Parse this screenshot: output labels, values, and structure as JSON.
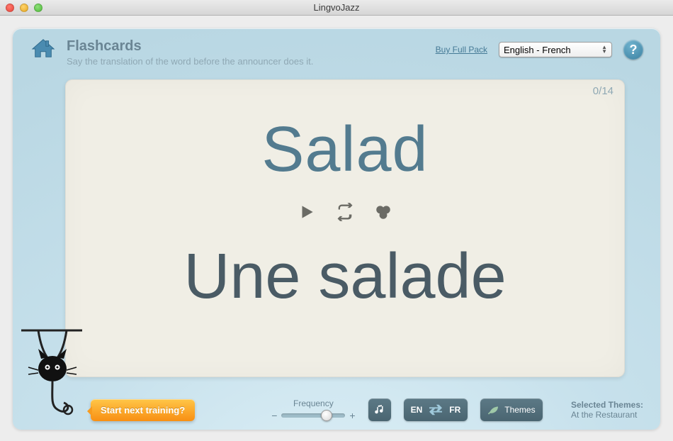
{
  "window": {
    "title": "LingvoJazz"
  },
  "header": {
    "title": "Flashcards",
    "subtitle": "Say the translation of the word before the announcer does it.",
    "buy_link": "Buy Full Pack",
    "lang_selected": "English - French"
  },
  "card": {
    "progress_current": "0",
    "progress_total": "14",
    "word_source": "Salad",
    "word_target": "Une salade"
  },
  "footer": {
    "start_label": "Start next training?",
    "frequency_label": "Frequency",
    "minus": "−",
    "plus": "+",
    "swap_left": "EN",
    "swap_right": "FR",
    "themes_label": "Themes",
    "selected_themes_label": "Selected Themes:",
    "selected_themes_value": "At the Restaurant"
  }
}
